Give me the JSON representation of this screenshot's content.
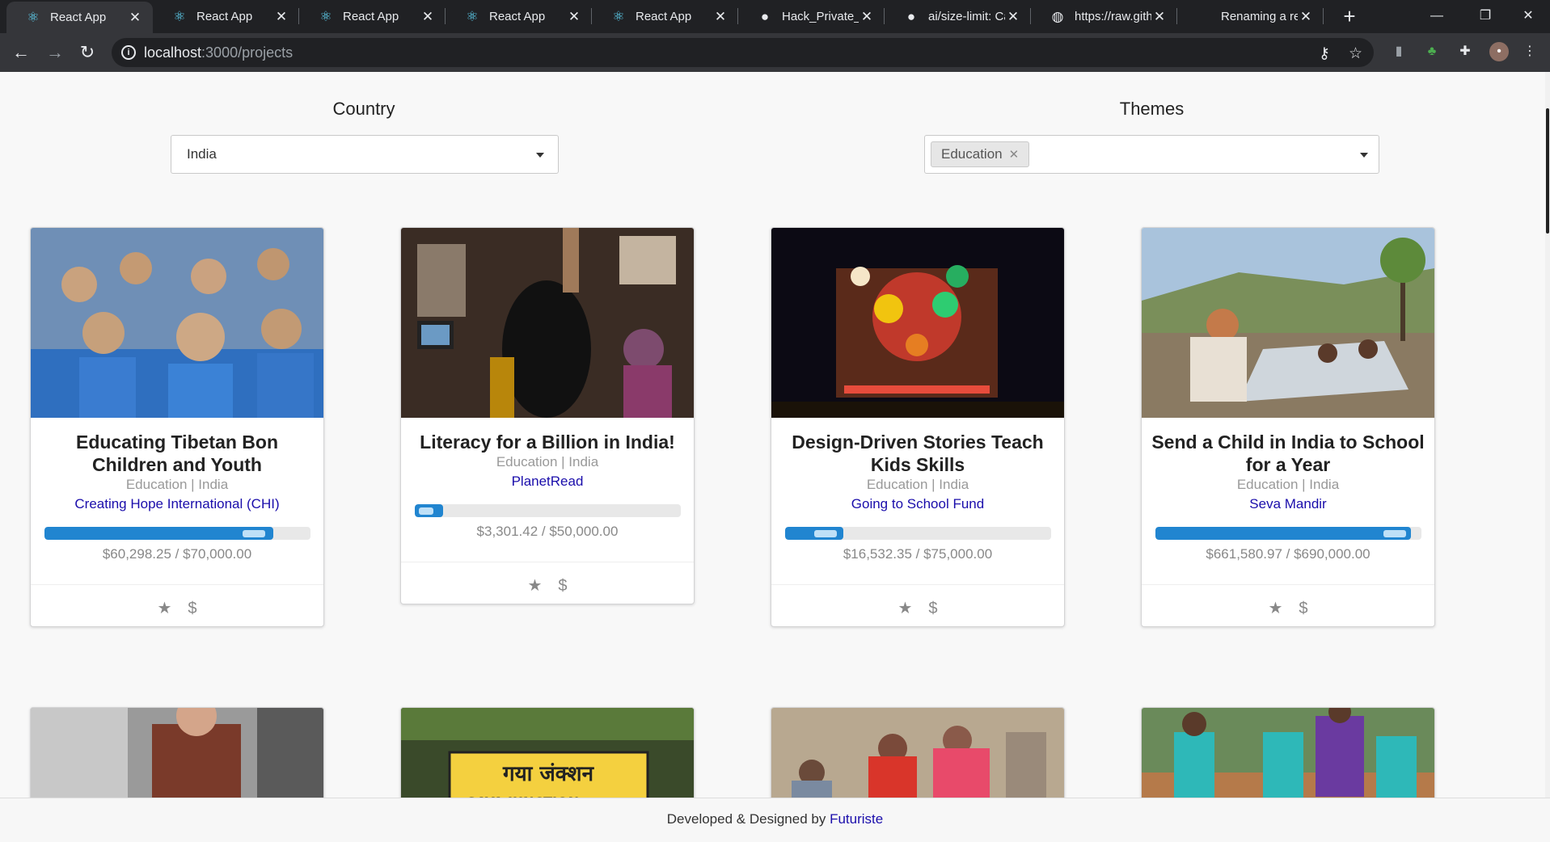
{
  "browser": {
    "tabs": [
      {
        "title": "React App",
        "icon": "react-icon",
        "active": true
      },
      {
        "title": "React App",
        "icon": "react-icon"
      },
      {
        "title": "React App",
        "icon": "react-icon"
      },
      {
        "title": "React App",
        "icon": "react-icon"
      },
      {
        "title": "React App",
        "icon": "react-icon"
      },
      {
        "title": "Hack_Private_re",
        "icon": "github-icon"
      },
      {
        "title": "ai/size-limit: Ca",
        "icon": "github-icon"
      },
      {
        "title": "https://raw.gith",
        "icon": "globe-icon"
      },
      {
        "title": "Renaming a rep",
        "icon": "none"
      }
    ],
    "url_host": "localhost",
    "url_path": ":3000/projects"
  },
  "filters": {
    "country_label": "Country",
    "country_value": "India",
    "themes_label": "Themes",
    "themes_chip": "Education"
  },
  "cards": [
    {
      "title": "Educating Tibetan Bon Children and Youth",
      "meta": "Education | India",
      "org": "Creating Hope International (CHI)",
      "amount": "$60,298.25 / $70,000.00",
      "progress": 0.86
    },
    {
      "title": "Literacy for a Billion in India!",
      "meta": "Education | India",
      "org": "PlanetRead",
      "amount": "$3,301.42 / $50,000.00",
      "progress": 0.07
    },
    {
      "title": "Design-Driven Stories Teach Kids Skills",
      "meta": "Education | India",
      "org": "Going to School Fund",
      "amount": "$16,532.35 / $75,000.00",
      "progress": 0.22
    },
    {
      "title": "Send a Child in India to School for a Year",
      "meta": "Education | India",
      "org": "Seva Mandir",
      "amount": "$661,580.97 / $690,000.00",
      "progress": 0.96
    }
  ],
  "bottom_row_sign": "गया जंक्शन",
  "bottom_row_sign2": "GAYA JUNCTION",
  "footer": {
    "prefix": "Developed & Designed by",
    "brand": "Futuriste"
  },
  "colors": {
    "progress": "#2185d0",
    "link": "#1a0dab"
  }
}
